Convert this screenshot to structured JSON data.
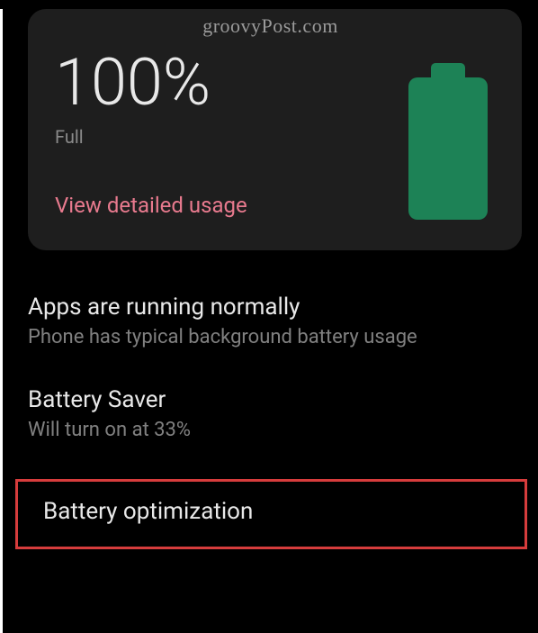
{
  "watermark": "groovyPost.com",
  "battery": {
    "percentage": "100%",
    "status": "Full",
    "detailed_link": "View detailed usage"
  },
  "items": {
    "apps_status": {
      "title": "Apps are running normally",
      "subtitle": "Phone has typical background battery usage"
    },
    "battery_saver": {
      "title": "Battery Saver",
      "subtitle": "Will turn on at 33%"
    },
    "battery_optimization": {
      "title": "Battery optimization"
    }
  }
}
